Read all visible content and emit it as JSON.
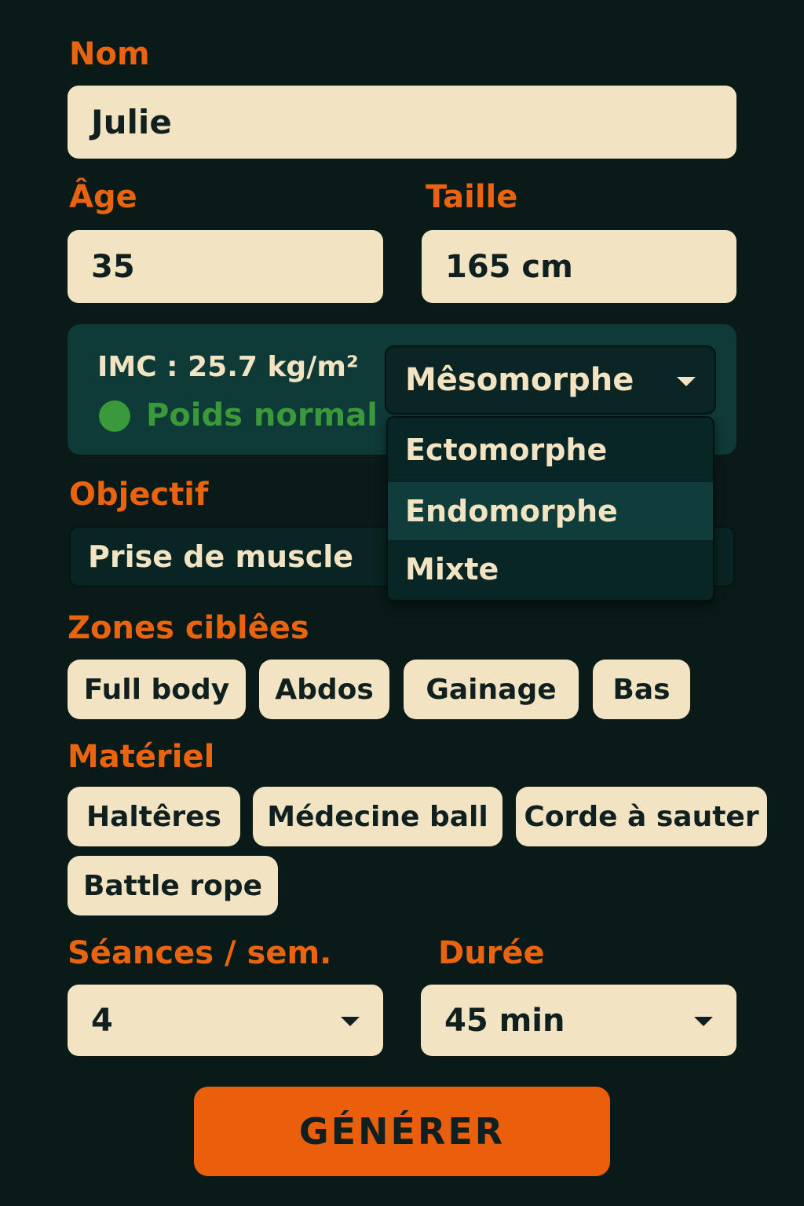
{
  "form": {
    "name": {
      "label": "Nom",
      "value": "Julie"
    },
    "age": {
      "label": "Âge",
      "value": "35"
    },
    "height": {
      "label": "Taille",
      "value": "165 cm"
    },
    "bmi": {
      "text": "IMC : 25.7 kg/m²",
      "status": "Poids normal",
      "status_color": "#3a9a3a"
    },
    "morphotype": {
      "selected": "Mêsomorphe",
      "options": [
        "Ectomorphe",
        "Endomorphe",
        "Mixte"
      ],
      "highlighted": "Endomorphe"
    },
    "goal": {
      "label": "Objectif",
      "value": "Prise de muscle"
    },
    "zones": {
      "label": "Zones ciblêes",
      "chips": [
        "Full body",
        "Abdos",
        "Gainage",
        "Bas"
      ]
    },
    "equipment": {
      "label": "Matériel",
      "chips": [
        "Haltêres",
        "Médecine ball",
        "Corde à sauter",
        "Battle rope"
      ]
    },
    "sessions": {
      "label": "Séances / sem.",
      "value": "4"
    },
    "duration": {
      "label": "Durée",
      "value": "45 min"
    },
    "submit_label": "GÉNÉRER"
  },
  "colors": {
    "background": "#0a1a19",
    "accent": "#ea6410",
    "field": "#f2e4c2",
    "card": "#0e3a38"
  }
}
